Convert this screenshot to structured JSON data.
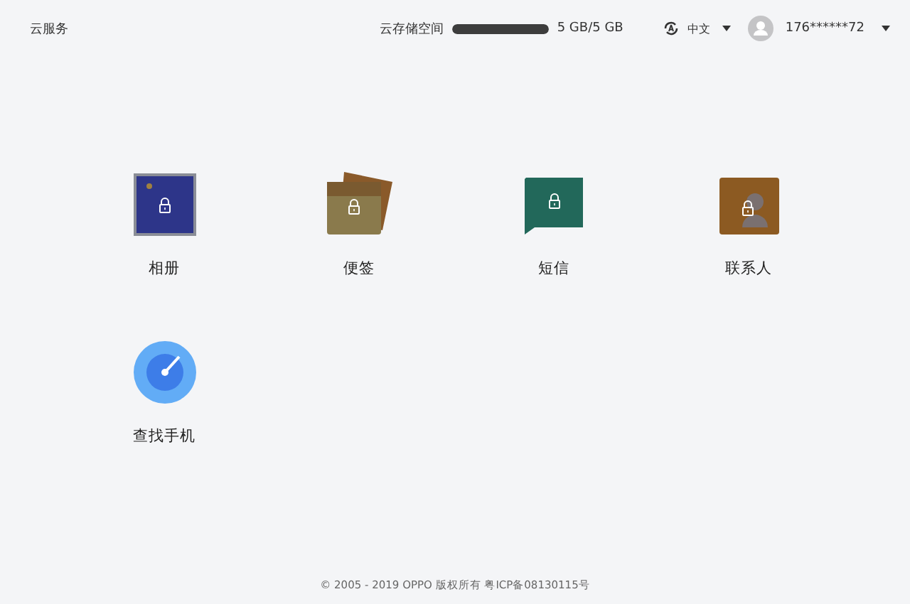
{
  "header": {
    "brand": "云服务",
    "storage": {
      "label": "云存储空间",
      "level": 1,
      "reading": "5 GB/5 GB"
    },
    "language": "中文",
    "account": "176******72"
  },
  "apps": [
    {
      "kind": "photos",
      "label": "相册",
      "locked": true
    },
    {
      "kind": "notes",
      "label": "便签",
      "locked": true
    },
    {
      "kind": "messages",
      "label": "短信",
      "locked": true
    },
    {
      "kind": "contacts",
      "label": "联系人",
      "locked": true
    },
    {
      "kind": "find-phone",
      "label": "查找手机",
      "locked": false
    }
  ],
  "footer": "© 2005 - 2019 OPPO 版权所有 粤ICP备08130115号"
}
